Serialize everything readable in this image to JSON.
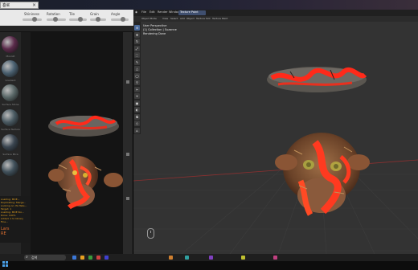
{
  "search": {
    "value": "흥로",
    "close_icon": "×"
  },
  "left_app": {
    "toolbar_labels": [
      "Shininess",
      "Rotation",
      "Tile",
      "Grain",
      "Angle"
    ],
    "materials": [
      {
        "label": "Moonlit",
        "color": "#5a2a4a"
      },
      {
        "label": "Gradient",
        "color": "#4a6070"
      },
      {
        "label": "Surface Stone",
        "color": "#5a6868"
      },
      {
        "label": "Surface Texture",
        "color": "#4a5a62"
      },
      {
        "label": "Surface Mica",
        "color": "#3a4550"
      },
      {
        "label": "",
        "color": "#40505a"
      }
    ],
    "log_lines": [
      "Loading: MDE...",
      "Duplicating: Merge...",
      "Looking on: PA Tabs...",
      "Target: 1",
      "Loading: MDE Slo...",
      "Done: 100%",
      "Added: 1 to library",
      "Fine..."
    ],
    "orange_text": "Lars\nRE"
  },
  "blender": {
    "menu": [
      "File",
      "Edit",
      "Render",
      "Window",
      "Help"
    ],
    "active_tab": "Texture Paint",
    "header": [
      "Object Mode",
      "View",
      "Select",
      "Add",
      "Object",
      "Texture Slot",
      "Texture Paint"
    ],
    "viewport_info": [
      "User Perspective",
      "(1) Collection | Suzanne",
      "Rendering Done"
    ],
    "tools": [
      "⊕",
      "✥",
      "↻",
      "⤢",
      "⬚",
      "✎",
      "△",
      "◯",
      "⚲",
      "✂",
      "⌖",
      "▣",
      "◐",
      "⧉",
      "◇",
      "⌂"
    ]
  },
  "taskbar": {
    "search_placeholder": "검색",
    "icons": [
      "#3b78d8",
      "#e8a020",
      "#3b9b3b",
      "#d04040",
      "#4040d0",
      "#d08030",
      "#30a0a0",
      "#8040c0",
      "#c0c030",
      "#c04080"
    ]
  }
}
